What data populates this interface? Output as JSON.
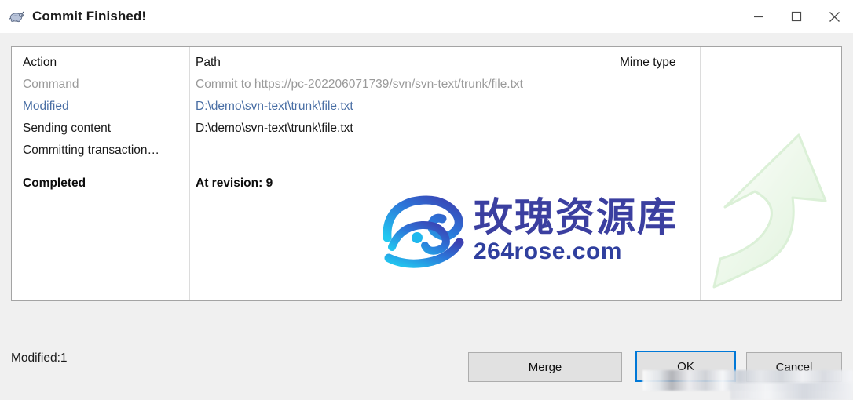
{
  "window": {
    "title": "Commit Finished!",
    "icon": "tortoise-icon",
    "controls": {
      "minimize": "–",
      "maximize": "☐",
      "close": "✕"
    }
  },
  "list": {
    "columns": [
      "Action",
      "Path",
      "Mime type",
      ""
    ],
    "rows": [
      {
        "action": "Action",
        "path": "Path",
        "mime": "Mime type",
        "extra": "",
        "style": "header"
      },
      {
        "action": "Command",
        "path": "Commit to https://pc-202206071739/svn/svn-text/trunk/file.txt",
        "mime": "",
        "extra": "",
        "style": "command"
      },
      {
        "action": "Modified",
        "path": "D:\\demo\\svn-text\\trunk\\file.txt",
        "mime": "",
        "extra": "",
        "style": "modified"
      },
      {
        "action": "Sending content",
        "path": "D:\\demo\\svn-text\\trunk\\file.txt",
        "mime": "",
        "extra": "",
        "style": "normal"
      },
      {
        "action": "Committing transaction…",
        "path": "",
        "mime": "",
        "extra": "",
        "style": "normal"
      },
      {
        "action": "Completed",
        "path": "At revision: 9",
        "mime": "",
        "extra": "",
        "style": "completed"
      }
    ]
  },
  "status": {
    "text": "Modified:1"
  },
  "buttons": {
    "merge": "Merge",
    "ok": "OK",
    "cancel": "Cancel"
  },
  "watermark": {
    "brand_cn": "玫瑰资源库",
    "brand_url": "264rose.com",
    "logo": "rose-spiral-logo",
    "background_icon": "green-curved-up-arrow"
  },
  "colors": {
    "accent": "#0078d7",
    "modified_text": "#4a6fa5",
    "command_text": "#9a9a9a",
    "watermark_blue": "#3b3fa0",
    "arrow_green": "#c9ecc4"
  }
}
